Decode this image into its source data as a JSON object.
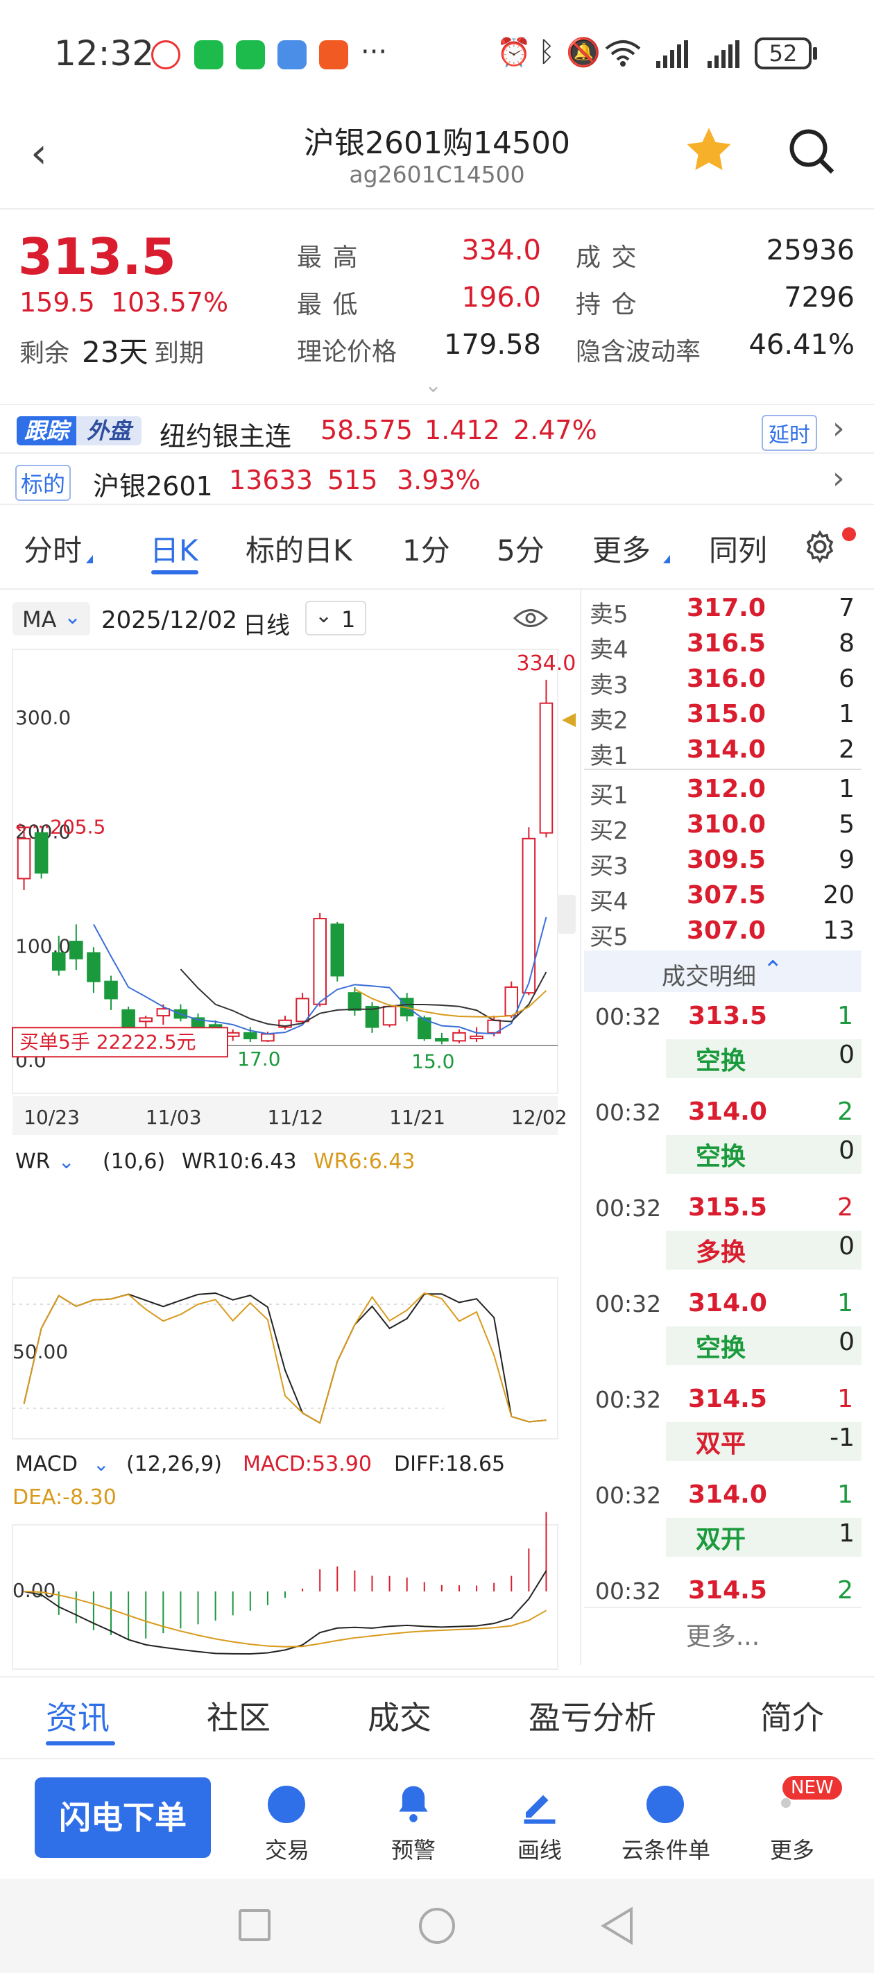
{
  "status_bar": {
    "time": "12:32",
    "more": "···",
    "battery": "52",
    "icons": [
      "alarm-icon",
      "bluetooth-icon",
      "mute-icon",
      "wifi-icon",
      "signal-icon",
      "signal-icon"
    ]
  },
  "header": {
    "title": "沪银2601购14500",
    "code": "ag2601C14500"
  },
  "quote": {
    "last_price": "313.5",
    "change": "159.5",
    "change_pct": "103.57%",
    "remaining_prefix": "剩余",
    "remaining_days": "23天",
    "remaining_suffix": "到期",
    "high_label": "最  高",
    "high": "334.0",
    "low_label": "最  低",
    "low": "196.0",
    "theoretical_label": "理论价格",
    "theoretical": "179.58",
    "volume_label": "成  交",
    "volume": "25936",
    "open_interest_label": "持  仓",
    "open_interest": "7296",
    "iv_label": "隐含波动率",
    "iv": "46.41%"
  },
  "foreign": {
    "badge_1": "跟踪",
    "badge_2": "外盘",
    "name": "纽约银主连",
    "price": "58.575",
    "change": "1.412",
    "change_pct": "2.47%",
    "delay": "延时"
  },
  "underlying": {
    "badge": "标的",
    "name": "沪银2601",
    "price": "13633",
    "change": "515",
    "change_pct": "3.93%"
  },
  "tabs": [
    "分时",
    "日K",
    "标的日K",
    "1分",
    "5分",
    "更多",
    "同列"
  ],
  "chart_header": {
    "indicator": "MA",
    "date": "2025/12/02",
    "period": "日线",
    "count": "1"
  },
  "chart_data": {
    "type": "candlestick",
    "y_ticks": [
      "300.0",
      "200.0",
      "100.0",
      "0.0"
    ],
    "x_ticks": [
      "10/23",
      "11/03",
      "11/12",
      "11/21",
      "12/02"
    ],
    "max_label": "334.0",
    "left_marker": "205.5",
    "low_labels": [
      "17.0",
      "15.0"
    ],
    "order_tag": "买单5手  22222.5元",
    "wr_header": {
      "name": "WR",
      "params": "(10,6)",
      "wr10": "WR10:6.43",
      "wr6": "WR6:6.43",
      "tick": "50.00"
    },
    "macd_header": {
      "name": "MACD",
      "params": "(12,26,9)",
      "macd": "MACD:53.90",
      "diff": "DIFF:18.65",
      "dea": "DEA:-8.30",
      "tick": "0.00"
    },
    "candles": [
      [
        160,
        205,
        150,
        195
      ],
      [
        200,
        195,
        160,
        165
      ],
      [
        95,
        110,
        75,
        80
      ],
      [
        105,
        120,
        80,
        90
      ],
      [
        95,
        100,
        60,
        70
      ],
      [
        70,
        75,
        45,
        55
      ],
      [
        45,
        48,
        25,
        30
      ],
      [
        35,
        40,
        30,
        38
      ],
      [
        40,
        50,
        32,
        46
      ],
      [
        45,
        50,
        35,
        38
      ],
      [
        38,
        42,
        28,
        30
      ],
      [
        32,
        36,
        20,
        22
      ],
      [
        22,
        28,
        18,
        25
      ],
      [
        25,
        30,
        17,
        20
      ],
      [
        18,
        26,
        17,
        24
      ],
      [
        30,
        40,
        28,
        36
      ],
      [
        35,
        60,
        33,
        55
      ],
      [
        50,
        130,
        48,
        125
      ],
      [
        120,
        122,
        70,
        75
      ],
      [
        60,
        65,
        40,
        45
      ],
      [
        48,
        52,
        25,
        30
      ],
      [
        32,
        50,
        30,
        48
      ],
      [
        55,
        60,
        35,
        40
      ],
      [
        38,
        40,
        18,
        20
      ],
      [
        20,
        25,
        15,
        18
      ],
      [
        18,
        28,
        16,
        25
      ],
      [
        20,
        30,
        17,
        22
      ],
      [
        25,
        40,
        22,
        36
      ],
      [
        40,
        70,
        38,
        65
      ],
      [
        60,
        205,
        58,
        195
      ],
      [
        200,
        334,
        196,
        313.5
      ]
    ],
    "ylim": [
      0,
      340
    ]
  },
  "order_book": {
    "asks": [
      {
        "label": "卖5",
        "price": "317.0",
        "vol": "7"
      },
      {
        "label": "卖4",
        "price": "316.5",
        "vol": "8"
      },
      {
        "label": "卖3",
        "price": "316.0",
        "vol": "6"
      },
      {
        "label": "卖2",
        "price": "315.0",
        "vol": "1"
      },
      {
        "label": "卖1",
        "price": "314.0",
        "vol": "2"
      }
    ],
    "bids": [
      {
        "label": "买1",
        "price": "312.0",
        "vol": "1"
      },
      {
        "label": "买2",
        "price": "310.0",
        "vol": "5"
      },
      {
        "label": "买3",
        "price": "309.5",
        "vol": "9"
      },
      {
        "label": "买4",
        "price": "307.5",
        "vol": "20"
      },
      {
        "label": "买5",
        "price": "307.0",
        "vol": "13"
      }
    ]
  },
  "trades_title": "成交明细",
  "trades": [
    {
      "time": "00:32",
      "price": "313.5",
      "vol": "1",
      "type": "空换",
      "type_vol": "0",
      "color": "green"
    },
    {
      "time": "00:32",
      "price": "314.0",
      "vol": "2",
      "type": "空换",
      "type_vol": "0",
      "color": "green"
    },
    {
      "time": "00:32",
      "price": "315.5",
      "vol": "2",
      "type": "多换",
      "type_vol": "0",
      "color": "red"
    },
    {
      "time": "00:32",
      "price": "314.0",
      "vol": "1",
      "type": "空换",
      "type_vol": "0",
      "color": "green"
    },
    {
      "time": "00:32",
      "price": "314.5",
      "vol": "1",
      "type": "双平",
      "type_vol": "-1",
      "color": "red"
    },
    {
      "time": "00:32",
      "price": "314.0",
      "vol": "1",
      "type": "双开",
      "type_vol": "1",
      "color": "green"
    },
    {
      "time": "00:32",
      "price": "314.5",
      "vol": "2"
    }
  ],
  "trades_more": "更多...",
  "bottom_tabs": [
    "资讯",
    "社区",
    "成交",
    "盈亏分析",
    "简介"
  ],
  "action_bar": {
    "quick_order": "闪电下单",
    "items": [
      "交易",
      "预警",
      "画线",
      "云条件单",
      "更多"
    ],
    "new_badge": "NEW"
  },
  "colors": {
    "up": "#d91d2e",
    "down": "#1a9a3c",
    "accent": "#2f6fe8"
  }
}
